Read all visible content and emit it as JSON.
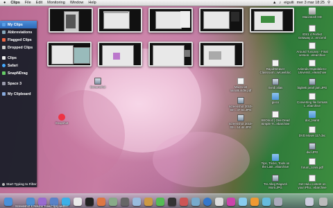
{
  "menubar": {
    "apple": "",
    "app_name": "Clips",
    "menus": [
      "File",
      "Edit",
      "Monitoring",
      "Window",
      "Help"
    ],
    "user": "eiguiti",
    "clock": "mer 3 mar 18:25"
  },
  "sidebar": {
    "items": [
      {
        "label": "My Clips",
        "selected": true
      },
      {
        "label": "Abbreviations",
        "selected": false
      },
      {
        "label": "Flagged Clips",
        "selected": false
      },
      {
        "label": "Dropped Clips",
        "selected": false
      },
      {
        "label": "Clips",
        "selected": false
      },
      {
        "label": "Safari",
        "selected": false
      },
      {
        "label": "SnapNDrag",
        "selected": false
      },
      {
        "label": "Space 3",
        "selected": false
      },
      {
        "label": "My Clipboard",
        "selected": false
      }
    ],
    "status": "Start Typing to Filter"
  },
  "desktop_icons": [
    {
      "label": "Macintosh HD",
      "kind": "disk"
    },
    {
      "label": "IOS1 4 Perfect Getaway 2...eml.eml",
      "kind": "file"
    },
    {
      "label": "Around Tuscany - Final version...elearchive",
      "kind": "file"
    },
    {
      "label": "Azienda Ospedaliero-Universit...elearchive",
      "kind": "file"
    },
    {
      "label": "biglietti pearl jam.JPG",
      "kind": "img"
    },
    {
      "label": "Converting file formats t...ebarchive",
      "kind": "file"
    },
    {
      "label": "doc_teamt",
      "kind": "folder"
    },
    {
      "label": "DVD Movie 117.dvc",
      "kind": "file"
    },
    {
      "label": "dvd.JPG",
      "kind": "img"
    },
    {
      "label": "forum_conni.pdf",
      "kind": "file"
    },
    {
      "label": "Get Hulu content on your iPho...ebarchive",
      "kind": "file"
    },
    {
      "label": "RapidWeaver Classroom...ws.webloc",
      "kind": "file"
    },
    {
      "label": "MacHeist nanoBundle.pdf",
      "kind": "file"
    },
    {
      "label": "rivedi alias",
      "kind": "img"
    },
    {
      "label": "gioco",
      "kind": "folder"
    },
    {
      "label": "screenshot 2010-03-...47.51.JPG",
      "kind": "img"
    },
    {
      "label": "SEOmoz | One Dead Simple Tr...ebarchive",
      "kind": "file"
    },
    {
      "label": "screenshot 2010-03-...14.44.JPG",
      "kind": "img"
    },
    {
      "label": "Tips, Tricks, Tools on the Last...ebarchive",
      "kind": "folder"
    },
    {
      "label": "Tre Alleg Ragazzi Morti.JPG",
      "kind": "img"
    },
    {
      "label": "Screenshot",
      "kind": "img"
    },
    {
      "label": "Snapshot",
      "kind": "app"
    }
  ],
  "dock": {
    "label": "Screenshot & Resizer Free(Clips).webloc"
  },
  "colors": {
    "sidebar_bg": "#191e28",
    "selection": "#3a7bcc",
    "dock_bg": "#7a8590"
  }
}
